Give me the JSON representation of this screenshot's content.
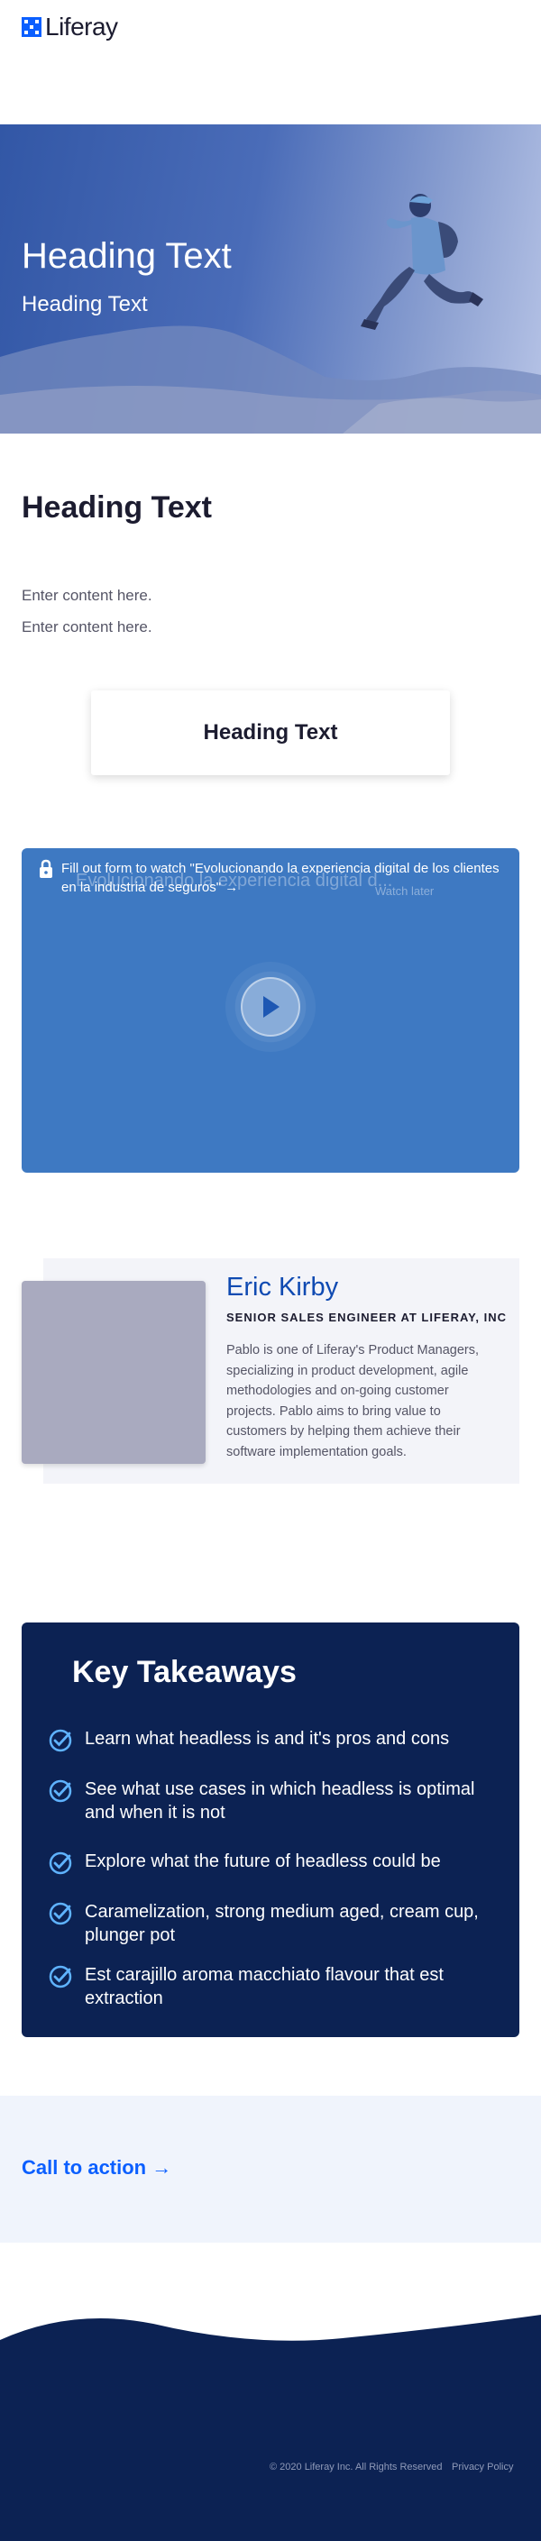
{
  "header": {
    "logo_text": "Liferay"
  },
  "hero": {
    "title": "Heading Text",
    "subtitle": "Heading Text"
  },
  "content": {
    "title": "Heading Text",
    "paragraphs": [
      "Enter content here.",
      "Enter content here."
    ],
    "card_title": "Heading Text"
  },
  "video": {
    "gate_message": "Fill out form to watch \"Evolucionando la experiencia digital de los clientes en la industria de seguros\" →",
    "ghost_title": "Evolucionando la experiencia digital d...",
    "ghost_watch_later": "Watch later",
    "play_icon": "play-icon",
    "lock_icon": "lock-icon"
  },
  "speaker": {
    "name": "Eric Kirby",
    "role": "SENIOR SALES ENGINEER AT LIFERAY, INC",
    "bio": "Pablo is one of Liferay's Product Managers, specializing in product development, agile methodologies and on-going customer projects. Pablo aims to bring value to customers by helping them achieve their software implementation goals."
  },
  "takeaways": {
    "title": "Key Takeaways",
    "items": [
      "Learn what headless is and it's pros and cons",
      "See what use cases in which headless is optimal and when it is not",
      "Explore what the future of headless could be",
      "Caramelization, strong medium aged, cream cup, plunger pot",
      "Est carajillo aroma macchiato flavour that est extraction"
    ]
  },
  "cta": {
    "label": "Call to action →"
  },
  "footer": {
    "copyright": "© 2020 Liferay Inc. All Rights Reserved",
    "privacy": "Privacy Policy"
  },
  "colors": {
    "brand_blue": "#0b5fff",
    "navy": "#0c2253",
    "video_blue": "#3e79c2",
    "check_blue": "#5fb3ff"
  }
}
